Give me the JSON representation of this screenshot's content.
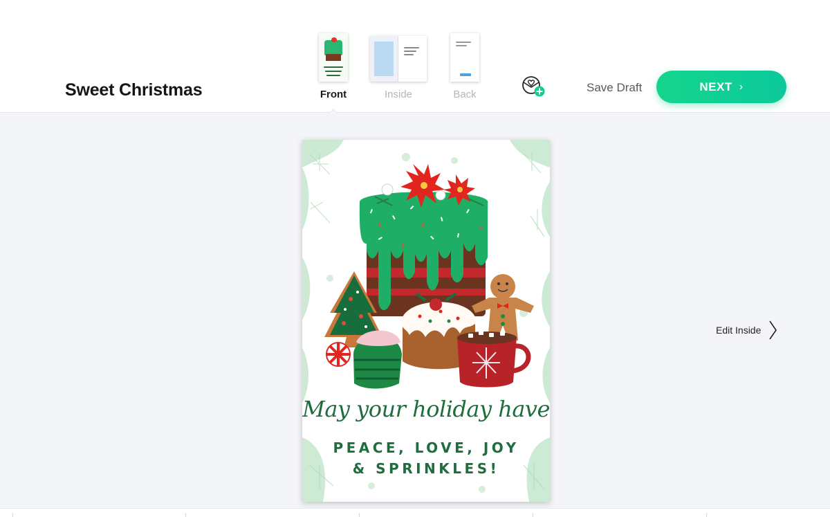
{
  "header": {
    "card_title": "Sweet Christmas",
    "save_draft_label": "Save Draft",
    "next_label": "NEXT"
  },
  "tabs": [
    {
      "label": "Front",
      "active": true
    },
    {
      "label": "Inside",
      "active": false
    },
    {
      "label": "Back",
      "active": false
    }
  ],
  "card": {
    "script_text": "May your holiday have",
    "message_line_1": "PEACE, LOVE, JOY",
    "message_line_2": "& SPRINKLES!"
  },
  "side_nav": {
    "edit_inside_label": "Edit Inside"
  },
  "icons": {
    "add_recipient": "heart-envelope-plus-icon",
    "next_chevron": "chevron-right-icon",
    "edit_inside_chevron": "chevron-right-icon"
  },
  "colors": {
    "accent": "#14d58c",
    "card_text_green": "#1e6d3d",
    "page_bg": "#f4f5f9"
  }
}
